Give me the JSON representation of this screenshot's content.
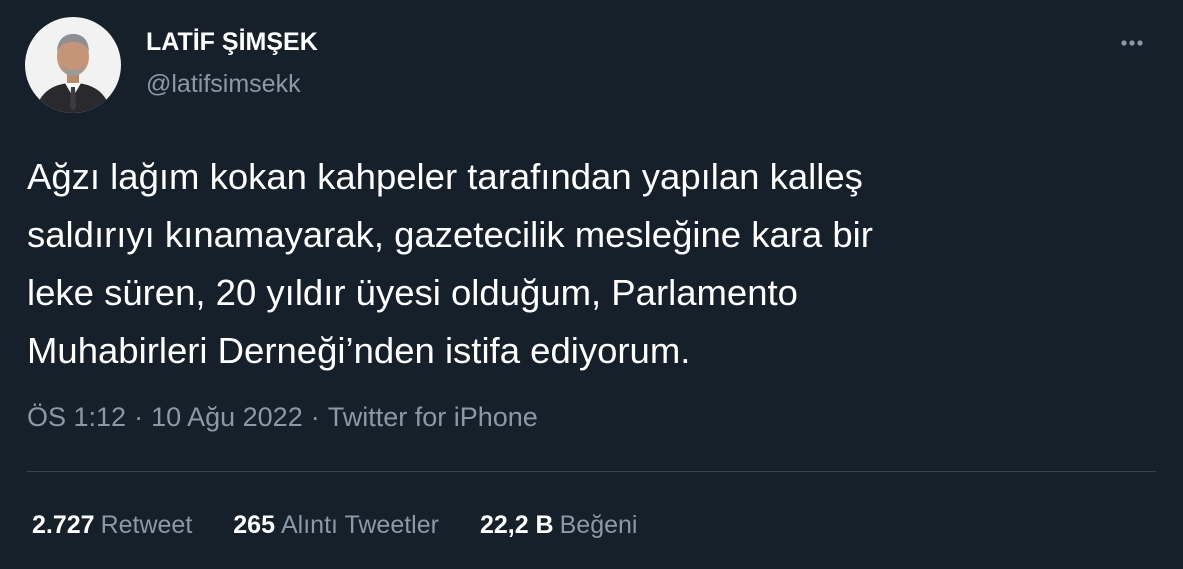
{
  "author": {
    "name": "LATİF ŞİMŞEK",
    "handle": "@latifsimsekk"
  },
  "tweet": {
    "text": "Ağzı lağım kokan kahpeler tarafından yapılan kalleş\nsaldırıyı kınamayarak, gazetecilik mesleğine kara bir\nleke süren, 20 yıldır üyesi olduğum, Parlamento\nMuhabirleri Derneği’nden istifa ediyorum."
  },
  "meta": {
    "time": "ÖS 1:12",
    "date": "10 Ağu 2022",
    "source": "Twitter for iPhone",
    "separator": "·"
  },
  "stats": {
    "retweets": {
      "count": "2.727",
      "label": "Retweet"
    },
    "quotes": {
      "count": "265",
      "label": "Alıntı Tweetler"
    },
    "likes": {
      "count": "22,2 B",
      "label": "Beğeni"
    }
  },
  "colors": {
    "background": "#15202b",
    "primary_text": "#ffffff",
    "secondary_text": "#8b98a5",
    "divider": "#38444d"
  },
  "icons": {
    "more": "more-options-icon"
  }
}
